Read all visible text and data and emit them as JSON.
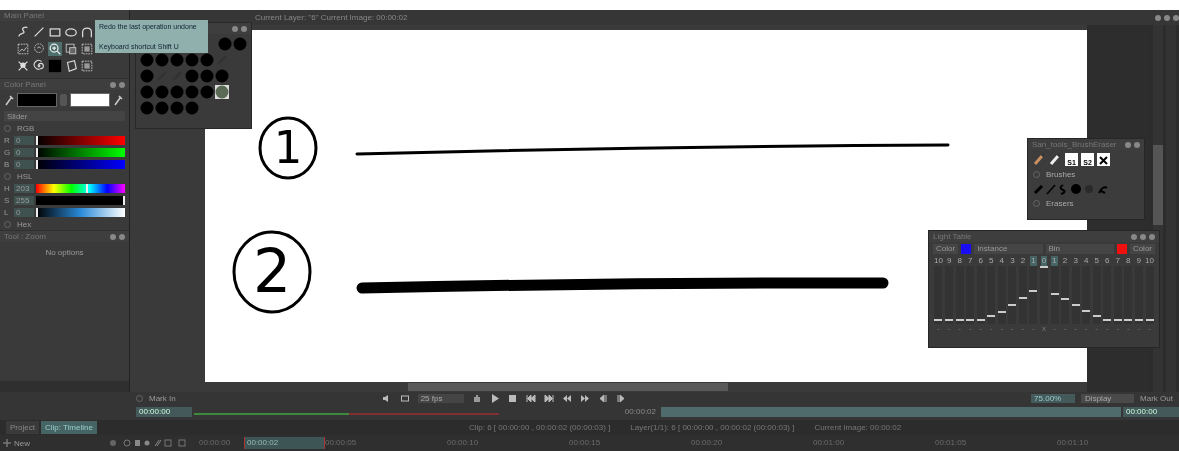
{
  "main_panel": {
    "title": "Main Panel",
    "tool_rows": [
      [
        {
          "kind": "curve",
          "selected": false
        },
        {
          "kind": "line",
          "selected": false
        },
        {
          "kind": "rectangle",
          "selected": false
        },
        {
          "kind": "ellipse",
          "selected": false
        },
        {
          "kind": "arc",
          "selected": false
        }
      ],
      [
        {
          "kind": "frame",
          "selected": false
        },
        {
          "kind": "lasso",
          "selected": false
        },
        {
          "kind": "zoom",
          "selected": true
        },
        {
          "kind": "crop",
          "selected": false
        },
        {
          "kind": "target",
          "selected": false
        }
      ],
      [
        {
          "kind": "cross",
          "selected": false
        },
        {
          "kind": "spiral",
          "selected": false
        },
        {
          "kind": "swatch",
          "selected": false
        },
        {
          "kind": "paper",
          "selected": false
        },
        {
          "kind": "target",
          "selected": false
        }
      ]
    ]
  },
  "tooltip": {
    "lines": [
      "Redo the last operation undone",
      "Keyboard shortcut Shift U"
    ]
  },
  "viewer": {
    "status": "Current Layer: \"6\"  Current Image: 00:00:02"
  },
  "color_panel": {
    "title": "Color Panel",
    "mode": "Slider",
    "groups": [
      {
        "label": "RGB",
        "channels": [
          {
            "name": "R",
            "value": "0",
            "kind": "red",
            "level": 0
          },
          {
            "name": "G",
            "value": "0",
            "kind": "green",
            "level": 0
          },
          {
            "name": "B",
            "value": "0",
            "kind": "blue",
            "level": 0
          }
        ]
      },
      {
        "label": "HSL",
        "channels": [
          {
            "name": "H",
            "value": "203",
            "kind": "hue",
            "level": 0.57
          },
          {
            "name": "S",
            "value": "255",
            "kind": "saturation",
            "level": 1
          },
          {
            "name": "L",
            "value": "0",
            "kind": "lightness",
            "level": 0
          }
        ]
      },
      {
        "label": "Hex"
      }
    ]
  },
  "tool_panel": {
    "title": "Tool : Zoom",
    "message": "No options"
  },
  "brush_palette": {
    "rows": [
      [
        {
          "kind": "dot",
          "selected": false
        },
        {
          "kind": "dot",
          "selected": false
        }
      ],
      [
        {
          "kind": "dot",
          "selected": false
        },
        {
          "kind": "dot",
          "selected": false
        },
        {
          "kind": "dot",
          "selected": false
        },
        {
          "kind": "dot",
          "selected": false
        },
        {
          "kind": "dot",
          "selected": false
        },
        {
          "kind": "stroke",
          "selected": false
        }
      ],
      [
        {
          "kind": "dot",
          "selected": false
        },
        {
          "kind": "stroke",
          "selected": false
        },
        {
          "kind": "stroke",
          "selected": false
        },
        {
          "kind": "dot",
          "selected": false
        },
        {
          "kind": "dot",
          "selected": false
        },
        {
          "kind": "dot",
          "selected": false
        }
      ],
      [
        {
          "kind": "dot",
          "selected": false
        },
        {
          "kind": "dot",
          "selected": false
        },
        {
          "kind": "dot",
          "selected": false
        },
        {
          "kind": "dot",
          "selected": false
        },
        {
          "kind": "dot",
          "selected": false
        },
        {
          "kind": "dot",
          "selected": true
        }
      ],
      [
        {
          "kind": "dot",
          "selected": false
        },
        {
          "kind": "dot",
          "selected": false
        },
        {
          "kind": "dot",
          "selected": false
        },
        {
          "kind": "dot",
          "selected": false
        }
      ]
    ]
  },
  "canvas": {
    "marks": [
      {
        "label": "1",
        "kind": "thin"
      },
      {
        "label": "2",
        "kind": "thick"
      }
    ]
  },
  "brush_panel": {
    "title": "San_tools_BrushEraser",
    "presets": [
      "S1",
      "S2"
    ],
    "sections": [
      "Brushes",
      "Erasers"
    ]
  },
  "light_table": {
    "title": "Light Table",
    "sides": [
      {
        "label": "Color",
        "color": "#1a0cf5",
        "mode": "Instance"
      },
      {
        "label": "Color",
        "color": "#f01010",
        "mode": "Bin"
      }
    ],
    "frames": [
      {
        "label": "10",
        "selected": false,
        "level": 0.05,
        "mark": "-"
      },
      {
        "label": "9",
        "selected": false,
        "level": 0.05,
        "mark": "-"
      },
      {
        "label": "8",
        "selected": false,
        "level": 0.05,
        "mark": "-"
      },
      {
        "label": "7",
        "selected": false,
        "level": 0.05,
        "mark": "-"
      },
      {
        "label": "6",
        "selected": false,
        "level": 0.05,
        "mark": "-"
      },
      {
        "label": "5",
        "selected": false,
        "level": 0.12,
        "mark": "-"
      },
      {
        "label": "4",
        "selected": false,
        "level": 0.2,
        "mark": "-"
      },
      {
        "label": "3",
        "selected": false,
        "level": 0.32,
        "mark": "-"
      },
      {
        "label": "2",
        "selected": false,
        "level": 0.45,
        "mark": "-"
      },
      {
        "label": "1",
        "selected": true,
        "level": 0.58,
        "mark": "-"
      },
      {
        "label": "0",
        "selected": true,
        "level": 1,
        "mark": "x"
      },
      {
        "label": "1",
        "selected": true,
        "level": 0.52,
        "mark": "-"
      },
      {
        "label": "2",
        "selected": false,
        "level": 0.42,
        "mark": "-"
      },
      {
        "label": "3",
        "selected": false,
        "level": 0.32,
        "mark": "-"
      },
      {
        "label": "4",
        "selected": false,
        "level": 0.22,
        "mark": "-"
      },
      {
        "label": "5",
        "selected": false,
        "level": 0.12,
        "mark": "-"
      },
      {
        "label": "6",
        "selected": false,
        "level": 0.05,
        "mark": "-"
      },
      {
        "label": "7",
        "selected": false,
        "level": 0.05,
        "mark": "-"
      },
      {
        "label": "8",
        "selected": false,
        "level": 0.05,
        "mark": "-"
      },
      {
        "label": "9",
        "selected": false,
        "level": 0.05,
        "mark": "-"
      },
      {
        "label": "10",
        "selected": false,
        "level": 0.05,
        "mark": "-"
      }
    ]
  },
  "playback": {
    "mark_in_label": "Mark In",
    "mark_in": "00:00:00",
    "fps": "25 fps",
    "current": "00:00:02",
    "zoom": "75.00%",
    "display": "Display",
    "mark_out_label": "Mark Out",
    "mark_out": "00:00:00"
  },
  "tabs": [
    {
      "label": "Project",
      "selected": false
    },
    {
      "label": "Clip: Timeline",
      "selected": true
    }
  ],
  "clip_info": [
    "Clip: 6 [ 00:00:00 , 00:00:02  (00:00:03) ]",
    "Layer(1/1): 6 [ 00:00:00 , 00:00:02  (00:00:03) ]",
    "Current Image: 00:00:02"
  ],
  "timeline": {
    "new_label": "New",
    "ticks": [
      {
        "label": "00:00:00",
        "selected": false
      },
      {
        "label": "00:00:02",
        "selected": true
      },
      {
        "label": "00:00:05",
        "selected": false
      },
      {
        "label": "00:00:10",
        "selected": false
      },
      {
        "label": "00:00:15",
        "selected": false
      },
      {
        "label": "00:00:20",
        "selected": false
      },
      {
        "label": "00:01:00",
        "selected": false
      },
      {
        "label": "00:01:05",
        "selected": false
      },
      {
        "label": "00:01:10",
        "selected": false
      }
    ]
  }
}
